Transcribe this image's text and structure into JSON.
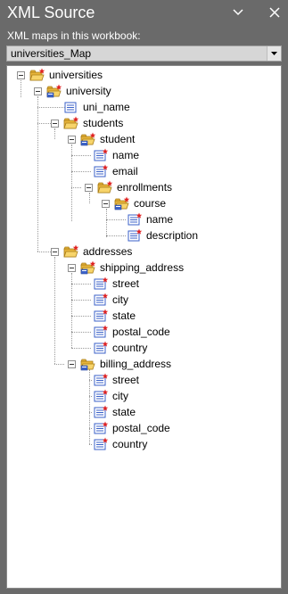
{
  "header": {
    "title": "XML Source"
  },
  "maps": {
    "label": "XML maps in this workbook:",
    "selected": "universities_Map"
  },
  "tree": {
    "universities": "universities",
    "university": "university",
    "uni_name": "uni_name",
    "students": "students",
    "student": "student",
    "student_name": "name",
    "student_email": "email",
    "enrollments": "enrollments",
    "course": "course",
    "course_name": "name",
    "course_description": "description",
    "addresses": "addresses",
    "shipping_address": "shipping_address",
    "shipping": [
      "street",
      "city",
      "state",
      "postal_code",
      "country"
    ],
    "billing_address": "billing_address",
    "billing": [
      "street",
      "city",
      "state",
      "postal_code",
      "country"
    ]
  },
  "colors": {
    "panel_bg": "#6a6a6a",
    "folder": "#f3c34a",
    "element_blue": "#3b62c8",
    "required_star": "#e02020"
  }
}
